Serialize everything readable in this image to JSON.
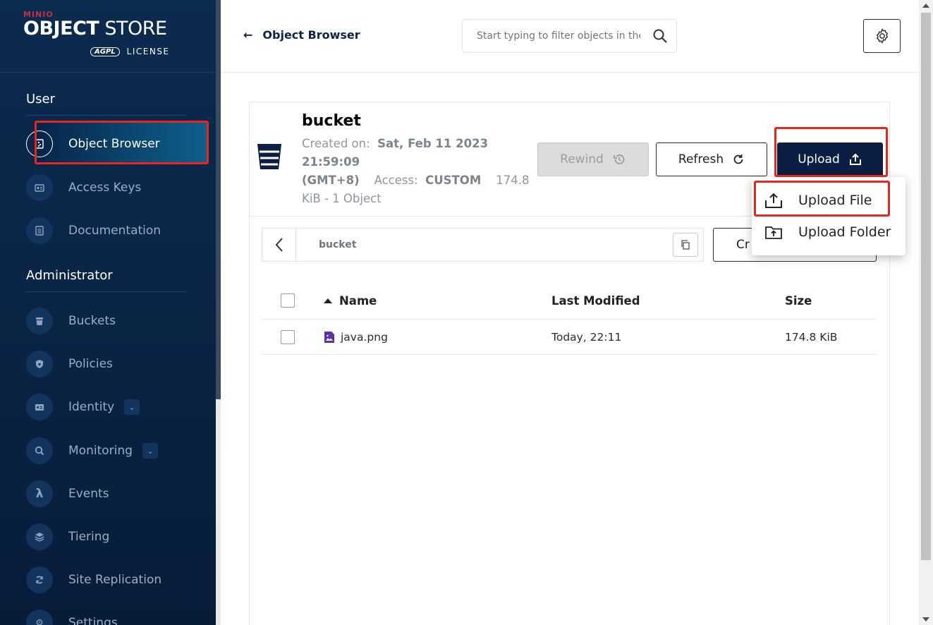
{
  "brand": {
    "minio": "MINIO",
    "product_bold": "OBJECT",
    "product_light": " STORE",
    "agpl": "AGPL",
    "license": "LICENSE"
  },
  "sidebar": {
    "user_section": "User",
    "admin_section": "Administrator",
    "user_items": [
      {
        "label": "Object Browser",
        "icon": "object-browser-icon"
      },
      {
        "label": "Access Keys",
        "icon": "access-keys-icon"
      },
      {
        "label": "Documentation",
        "icon": "documentation-icon"
      }
    ],
    "admin_items": [
      {
        "label": "Buckets",
        "icon": "buckets-icon"
      },
      {
        "label": "Policies",
        "icon": "policies-icon"
      },
      {
        "label": "Identity",
        "icon": "identity-icon"
      },
      {
        "label": "Monitoring",
        "icon": "monitoring-icon"
      },
      {
        "label": "Events",
        "icon": "lambda-icon"
      },
      {
        "label": "Tiering",
        "icon": "tiering-icon"
      },
      {
        "label": "Site Replication",
        "icon": "site-replication-icon"
      },
      {
        "label": "Settings",
        "icon": "settings-icon"
      }
    ]
  },
  "header": {
    "back_label": "Object Browser",
    "search_placeholder": "Start typing to filter objects in the bucket"
  },
  "bucket": {
    "name": "bucket",
    "created_label": "Created on:",
    "created_value": "Sat, Feb 11 2023 21:59:09 (GMT+8)",
    "access_label": "Access:",
    "access_value": "CUSTOM",
    "usage": "174.8 KiB - 1 Object"
  },
  "actions": {
    "rewind": "Rewind",
    "refresh": "Refresh",
    "upload": "Upload",
    "create_partial": "Cr"
  },
  "breadcrumb": {
    "path": "bucket"
  },
  "table": {
    "columns": {
      "name": "Name",
      "modified": "Last Modified",
      "size": "Size"
    },
    "rows": [
      {
        "name": "java.png",
        "modified": "Today, 22:11",
        "size": "174.8 KiB"
      }
    ]
  },
  "upload_menu": {
    "items": [
      "Upload File",
      "Upload Folder"
    ]
  },
  "colors": {
    "sidebar_bg": "#0a2546",
    "upload_btn": "#0b1f44",
    "highlight": "#e8261c"
  }
}
